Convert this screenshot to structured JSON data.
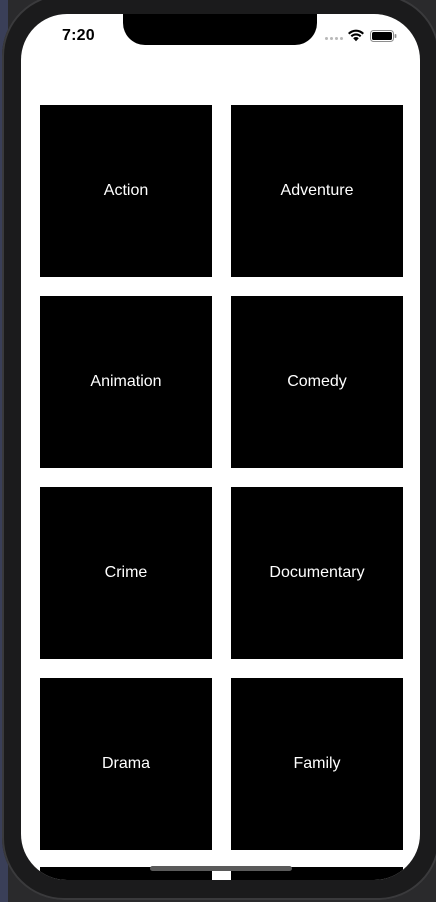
{
  "status_bar": {
    "time": "7:20",
    "icons": [
      "signal-dots-icon",
      "wifi-icon",
      "battery-icon"
    ]
  },
  "genres": [
    {
      "label": "Action"
    },
    {
      "label": "Adventure"
    },
    {
      "label": "Animation"
    },
    {
      "label": "Comedy"
    },
    {
      "label": "Crime"
    },
    {
      "label": "Documentary"
    },
    {
      "label": "Drama"
    },
    {
      "label": "Family"
    }
  ],
  "colors": {
    "tile_background": "#000000",
    "tile_text": "#ffffff",
    "screen_background": "#ffffff"
  }
}
